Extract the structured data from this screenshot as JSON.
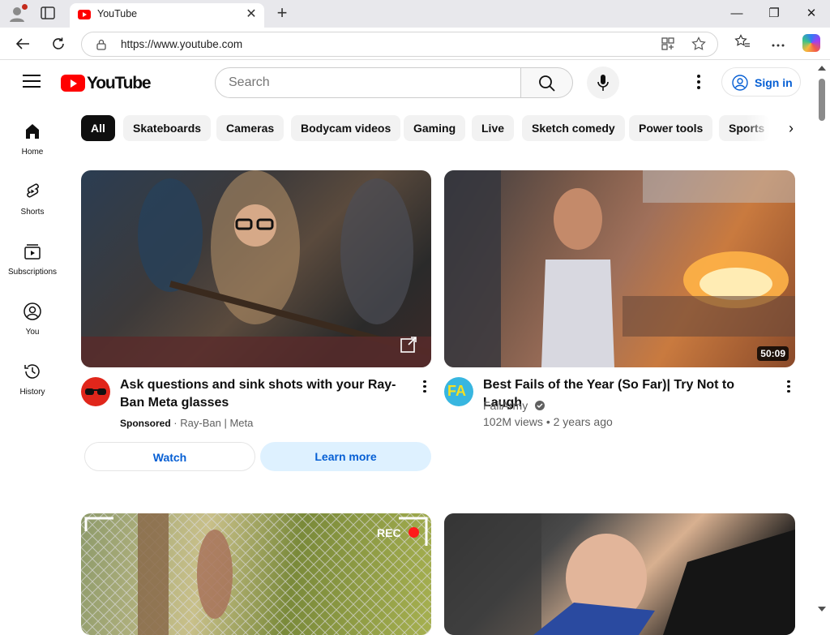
{
  "browser": {
    "tab_title": "YouTube",
    "url": "https://www.youtube.com",
    "new_tab_symbol": "+",
    "tab_close_symbol": "✕",
    "window_controls": {
      "minimize": "—",
      "restore": "❐",
      "close": "✕"
    },
    "icons": [
      "profile-icon",
      "tab-actions-icon",
      "back-icon",
      "refresh-icon",
      "site-info-icon",
      "apps-icon",
      "favorite-star-icon",
      "favorites-icon",
      "settings-more-icon",
      "copilot-icon"
    ]
  },
  "header": {
    "logo_text": "YouTube",
    "search_placeholder": "Search",
    "signin_label": "Sign in"
  },
  "sidebar": {
    "items": [
      {
        "label": "Home",
        "icon": "home-icon"
      },
      {
        "label": "Shorts",
        "icon": "shorts-icon"
      },
      {
        "label": "Subscriptions",
        "icon": "subscriptions-icon"
      },
      {
        "label": "You",
        "icon": "you-icon"
      },
      {
        "label": "History",
        "icon": "history-icon"
      }
    ]
  },
  "chips": [
    "All",
    "Skateboards",
    "Cameras",
    "Bodycam videos",
    "Gaming",
    "Live",
    "Sketch comedy",
    "Power tools",
    "Sports"
  ],
  "chips_next_symbol": "›",
  "videos": [
    {
      "title": "Ask questions and sink shots with your Ray-Ban Meta glasses",
      "sponsored_label": "Sponsored",
      "separator": "·",
      "advertiser": "Ray-Ban | Meta",
      "watch_label": "Watch",
      "learn_more_label": "Learn more"
    },
    {
      "title": "Best Fails of the Year (So Far)| Try Not to Laugh",
      "channel": "FailArmy",
      "avatar_text": "FA",
      "views": "102M views",
      "separator": "•",
      "age": "2 years ago",
      "duration": "50:09"
    },
    {
      "overlay_text": "REC"
    },
    {}
  ],
  "colors": {
    "brand_red": "#ff0000",
    "link_blue": "#065fd4",
    "chip_bg": "#f2f2f2",
    "chip_active_bg": "#0f0f0f"
  }
}
